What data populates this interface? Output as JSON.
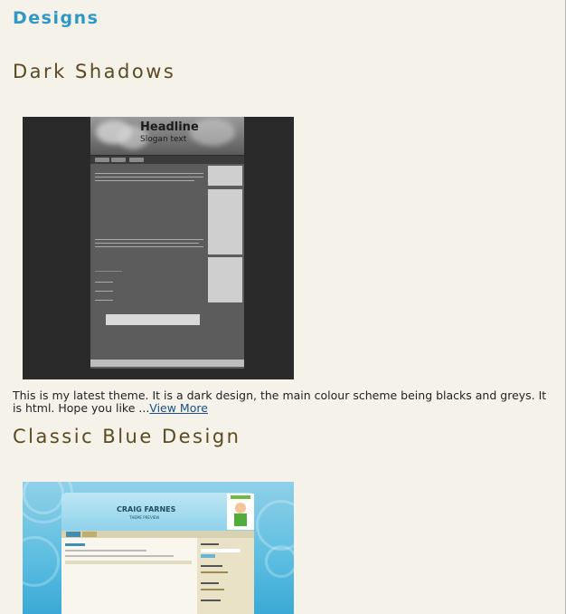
{
  "page": {
    "heading": "Designs"
  },
  "posts": [
    {
      "title": "Dark Shadows",
      "thumbnail": {
        "headline": "Headline",
        "slogan": "Slogan text"
      },
      "excerpt": "This is my latest theme. It is a dark design, the main colour scheme being blacks and greys. It is html. Hope you like ...",
      "link_label": "View More"
    },
    {
      "title": "Classic Blue Design",
      "thumbnail": {
        "site_title": "CRAIG FARNES",
        "site_subtitle": "THEME PREVIEW"
      }
    }
  ],
  "colors": {
    "heading": "#2f98c4",
    "title": "#5b4a21",
    "link": "#1a4f8b",
    "background": "#f5f2ea"
  }
}
